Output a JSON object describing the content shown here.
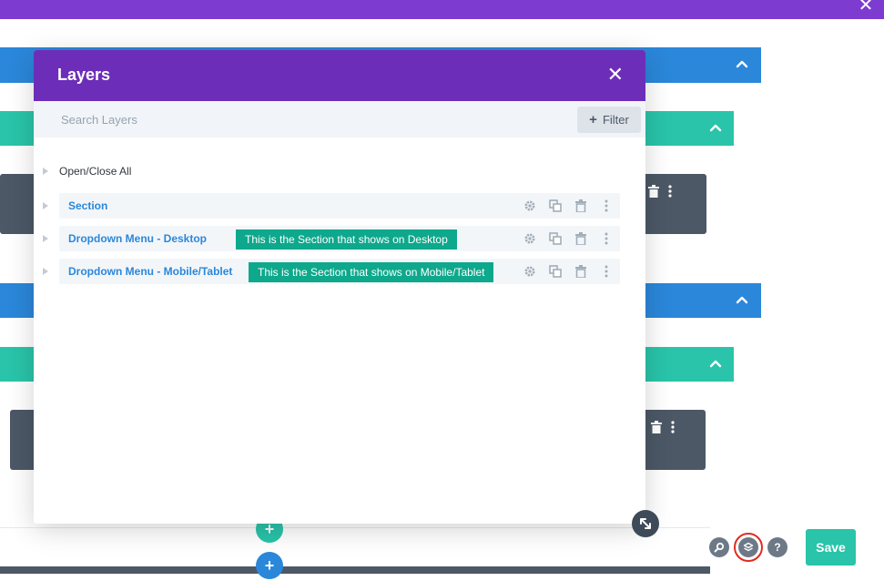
{
  "modal": {
    "title": "Layers",
    "search_placeholder": "Search Layers",
    "filter_label": "Filter",
    "open_close_label": "Open/Close All",
    "layers": [
      {
        "name": "Section",
        "tooltip": ""
      },
      {
        "name": "Dropdown Menu - Desktop",
        "tooltip": "This is the Section that shows on Desktop"
      },
      {
        "name": "Dropdown Menu - Mobile/Tablet",
        "tooltip": "This is the Section that shows on Mobile/Tablet"
      }
    ]
  },
  "toolbar": {
    "help_label": "?",
    "save_label": "Save"
  },
  "colors": {
    "divi_purple": "#7e3bd0",
    "modal_header": "#6c2eb9",
    "section_blue": "#2b87da",
    "row_teal": "#29c4a9",
    "tooltip_green": "#0ea88c",
    "module_dark": "#4c5866",
    "highlight_red": "#e02b20"
  },
  "icons": {
    "close": "close-icon",
    "chevron": "chevron-up-icon",
    "settings": "gear-icon",
    "duplicate": "duplicate-icon",
    "delete": "trash-icon",
    "more": "more-vertical-icon",
    "resize": "resize-icon",
    "zoom": "zoom-icon",
    "layers": "layers-icon",
    "help": "help-icon",
    "add": "plus-icon"
  }
}
